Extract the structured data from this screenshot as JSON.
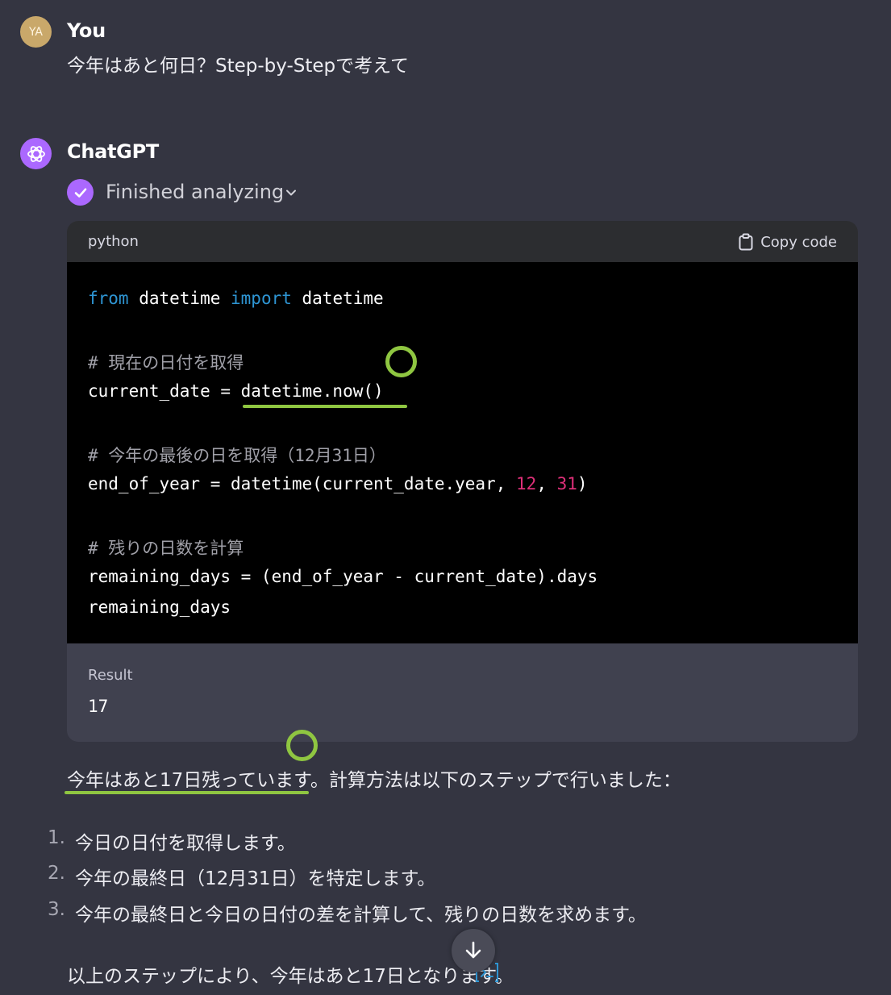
{
  "user": {
    "initials": "YA",
    "name": "You",
    "message": "今年はあと何日？Step-by-Stepで考えて"
  },
  "assistant": {
    "name": "ChatGPT",
    "status": "Finished analyzing",
    "code_block": {
      "language": "python",
      "copy_label": "Copy code",
      "lines": {
        "l1": {
          "kw1": "from",
          "t1": " datetime ",
          "kw2": "import",
          "t2": " datetime"
        },
        "c1": "# 現在の日付を取得",
        "l2": "current_date = datetime.now()",
        "c2": "# 今年の最後の日を取得（12月31日）",
        "l3": {
          "t1": "end_of_year = datetime(current_date.year, ",
          "n1": "12",
          "t2": ", ",
          "n2": "31",
          "t3": ")"
        },
        "c3": "# 残りの日数を計算",
        "l4": "remaining_days = (end_of_year - current_date).days",
        "l5": "remaining_days"
      },
      "result_label": "Result",
      "result_value": "17"
    },
    "answer": {
      "intro": "今年はあと17日残っています。計算方法は以下のステップで行いました：",
      "steps": [
        {
          "num": "1.",
          "text": "今日の日付を取得します。"
        },
        {
          "num": "2.",
          "text": "今年の最終日（12月31日）を特定します。"
        },
        {
          "num": "3.",
          "text": "今年の最終日と今日の日付の差を計算して、残りの日数を求めます。"
        }
      ],
      "conclusion": "以上のステップにより、今年はあと17日となります。"
    }
  },
  "colors": {
    "background": "#343541",
    "accent_purple": "#ab68ff",
    "annotation_green": "#8fc641",
    "keyword_blue": "#2e95d3",
    "number_pink": "#df3079"
  },
  "icons": {
    "check": "check-icon",
    "chevron": "chevron-down-icon",
    "copy": "clipboard-icon",
    "scroll": "arrow-down-icon",
    "citation": "code-interpreter-icon"
  }
}
